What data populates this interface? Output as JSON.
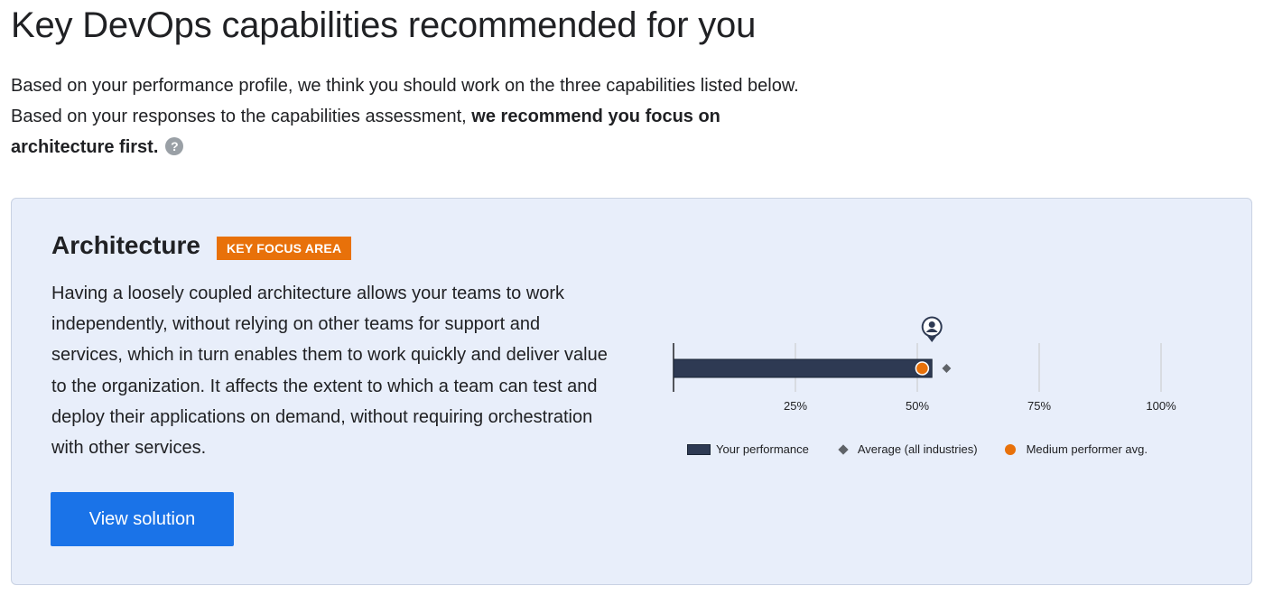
{
  "header": {
    "title": "Key DevOps capabilities recommended for you",
    "intro_line1": "Based on your performance profile, we think you should work on the three capabilities listed below.",
    "intro_line2_prefix": "Based on your responses to the capabilities assessment, ",
    "intro_line2_bold_a": "we recommend you focus on",
    "intro_line2_bold_b": "architecture first.",
    "help_icon": "?"
  },
  "card": {
    "title": "Architecture",
    "badge": "KEY FOCUS AREA",
    "description": "Having a loosely coupled architecture allows your teams to work independently, without relying on other teams for support and services, which in turn enables them to work quickly and deliver value to the organization. It affects the extent to which a team can test and deploy their applications on demand, without requiring orchestration with other services.",
    "button_label": "View solution"
  },
  "chart_data": {
    "type": "bar",
    "orientation": "horizontal",
    "xlim": [
      0,
      100
    ],
    "x_ticks": [
      "25%",
      "50%",
      "75%",
      "100%"
    ],
    "x_tick_values": [
      25,
      50,
      75,
      100
    ],
    "your_performance": 53,
    "average_all_industries": 56,
    "medium_performer_avg": 51,
    "user_marker_icon": "person-pin-icon",
    "legend": {
      "your_performance": "Your performance",
      "average": "Average (all industries)",
      "medium": "Medium performer avg."
    },
    "colors": {
      "bar": "#2e3a53",
      "average": "#5f6368",
      "medium": "#e8710a",
      "grid": "#c8c8c8"
    }
  }
}
